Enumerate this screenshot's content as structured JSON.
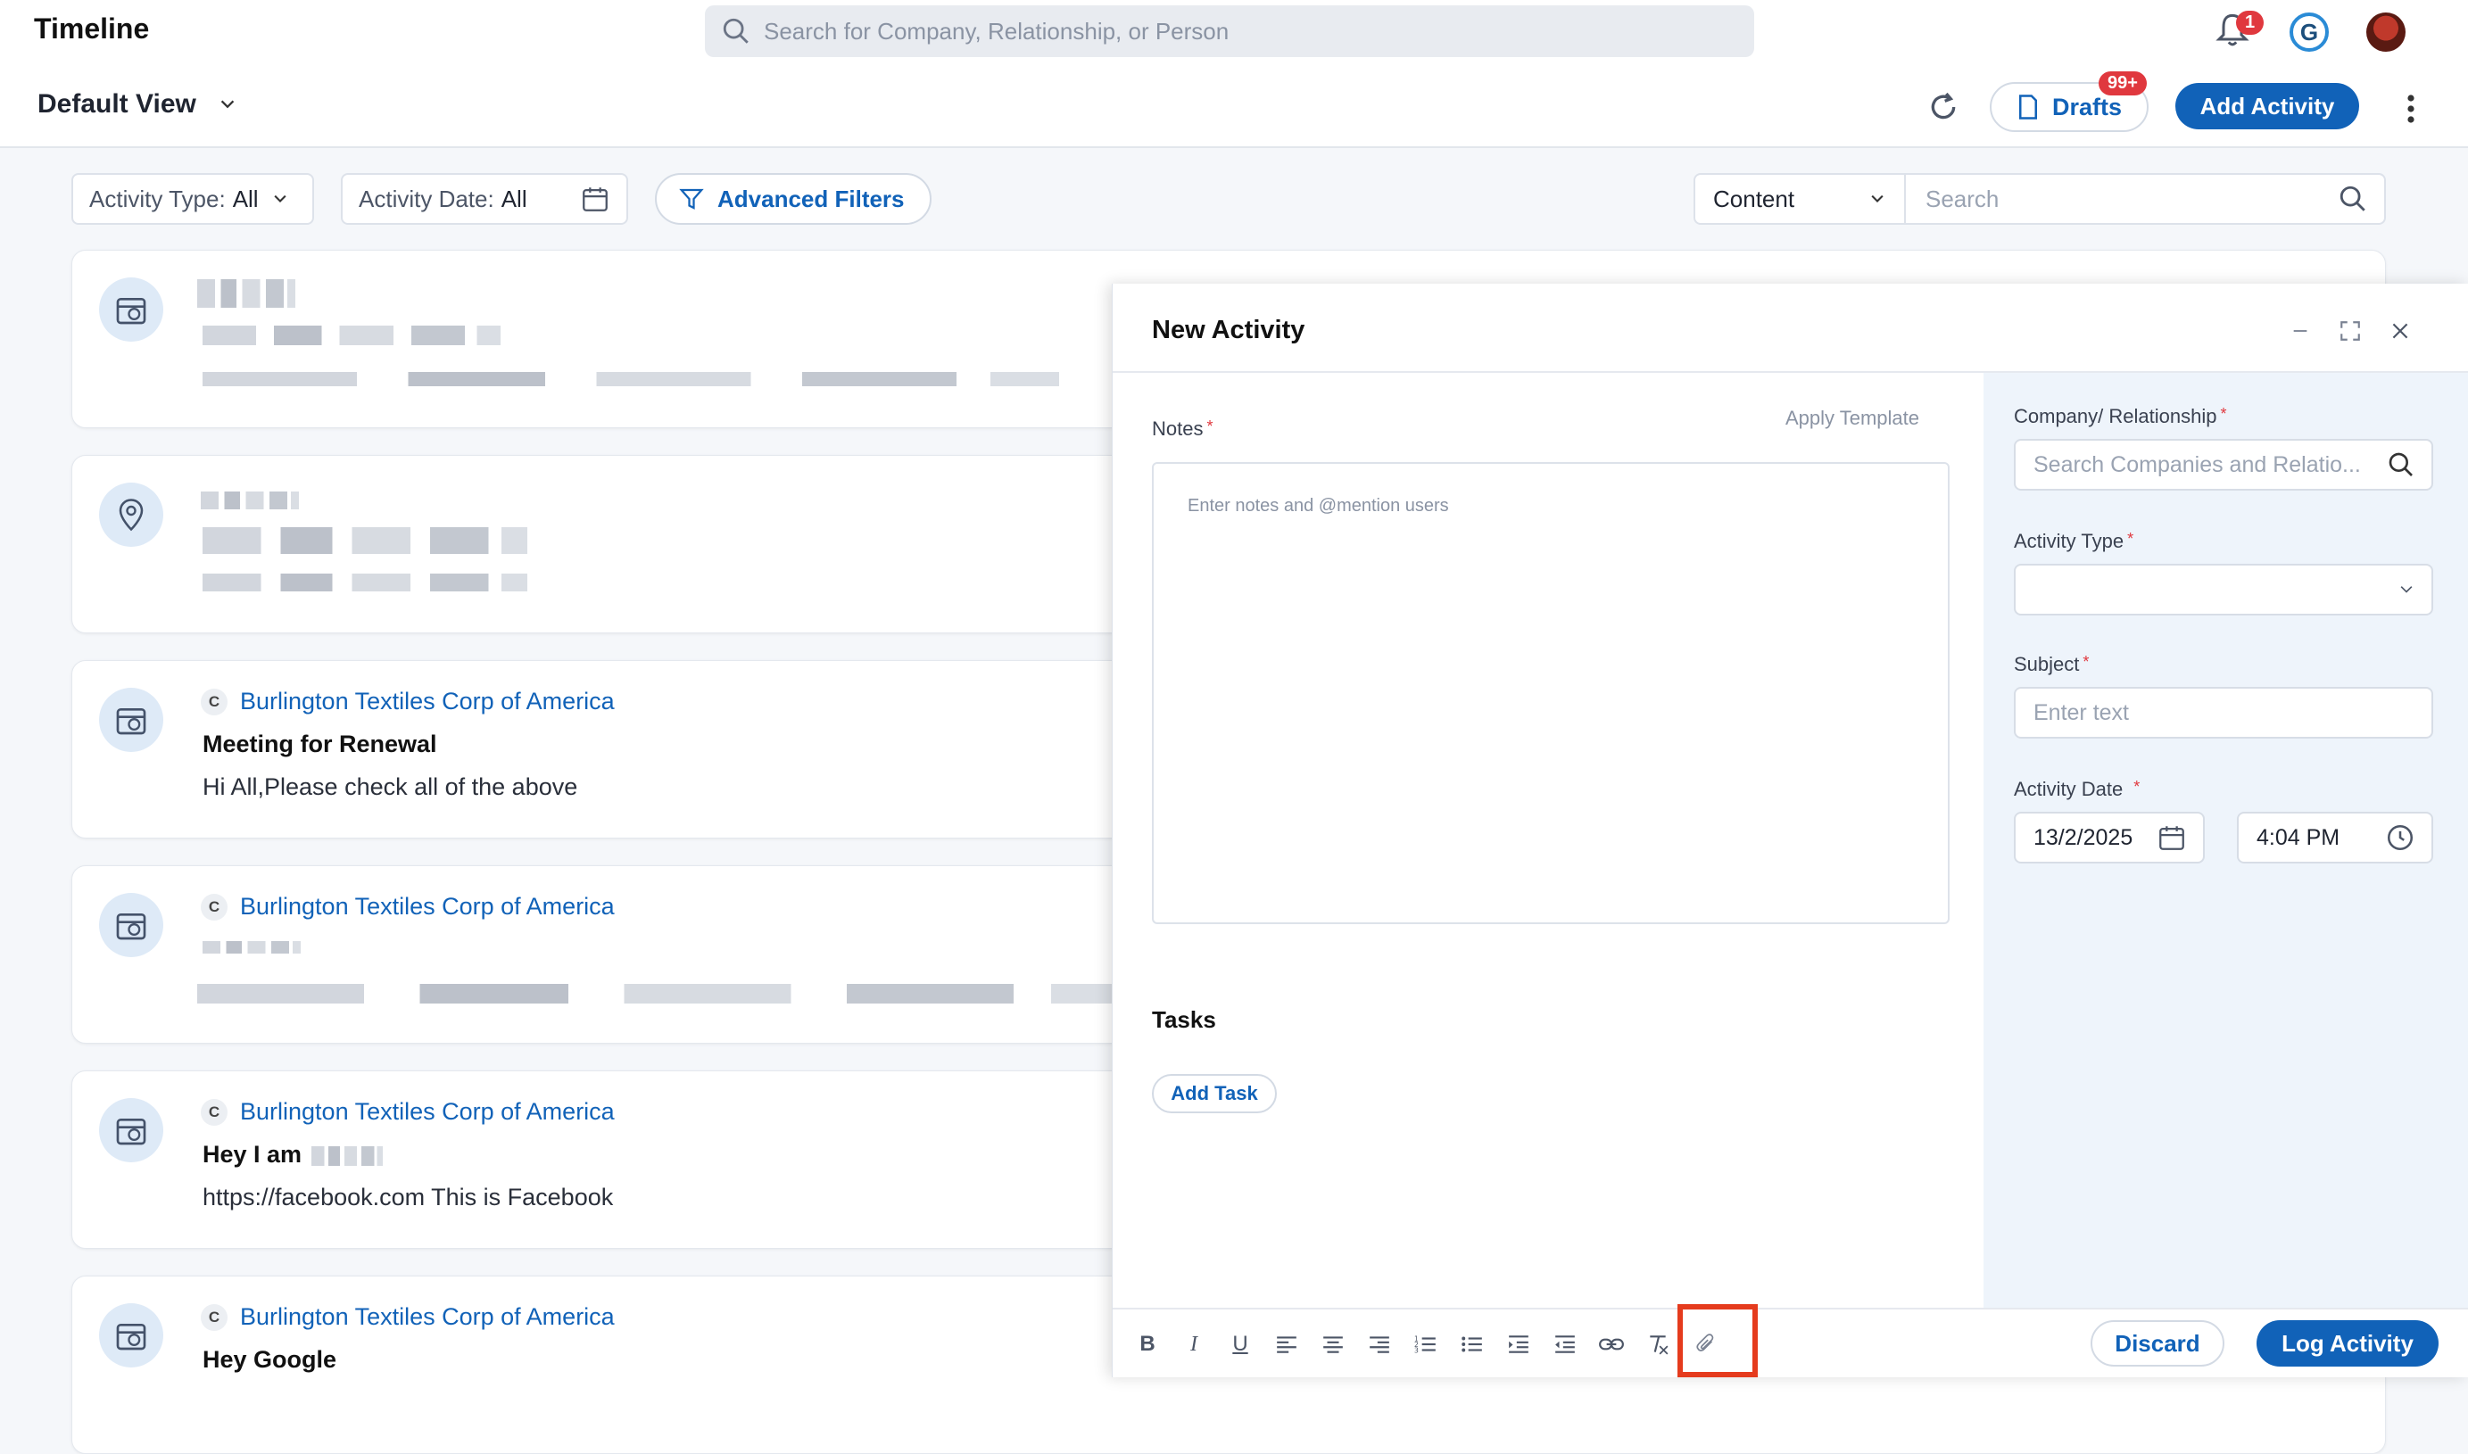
{
  "header": {
    "title": "Timeline",
    "search_placeholder": "Search for Company, Relationship, or Person",
    "notification_count": "1",
    "view_name": "Default View",
    "drafts_label": "Drafts",
    "drafts_count": "99+",
    "add_activity_label": "Add Activity"
  },
  "filters": {
    "activity_type_label": "Activity Type:",
    "activity_type_value": "All",
    "activity_date_label": "Activity Date:",
    "activity_date_value": "All",
    "advanced_filters_label": "Advanced Filters",
    "content_select_value": "Content",
    "search_placeholder": "Search"
  },
  "cards": [
    {
      "company": "Burlington Textiles Corp of America",
      "title": "Meeting for Renewal",
      "text": "Hi All,Please check all of the above"
    },
    {
      "company": "Burlington Textiles Corp of America"
    },
    {
      "company": "Burlington Textiles Corp of America",
      "title": "Hey I am",
      "text": "https://facebook.com This is Facebook"
    },
    {
      "company": "Burlington Textiles Corp of America",
      "title": "Hey Google"
    }
  ],
  "company_chip": "C",
  "panel": {
    "title": "New Activity",
    "notes_label": "Notes",
    "apply_template_label": "Apply Template",
    "notes_placeholder": "Enter notes and @mention users",
    "tasks_label": "Tasks",
    "add_task_label": "Add Task",
    "company_label": "Company/ Relationship",
    "company_placeholder": "Search Companies and Relatio...",
    "activity_type_label": "Activity Type",
    "subject_label": "Subject",
    "subject_placeholder": "Enter text",
    "activity_date_label": "Activity Date",
    "date_value": "13/2/2025",
    "time_value": "4:04 PM",
    "required_mark": "*",
    "discard_label": "Discard",
    "log_label": "Log Activity"
  },
  "toolbar": {
    "bold": "B",
    "italic": "I",
    "underline": "U"
  },
  "colors": {
    "accent": "#1162b8",
    "danger": "#e0383e",
    "highlight": "#e53b1d"
  }
}
